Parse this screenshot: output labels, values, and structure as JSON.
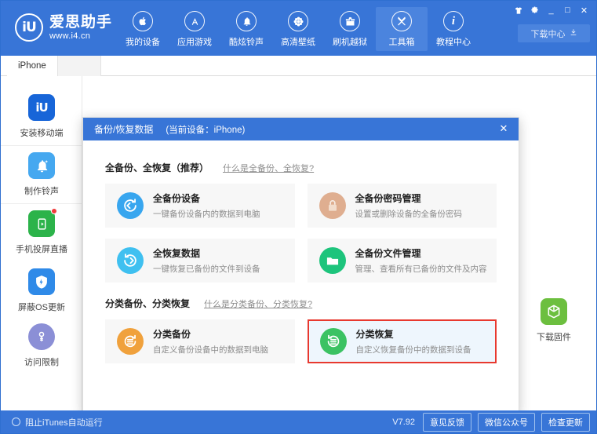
{
  "header": {
    "logo_mark": "iU",
    "brand_cn": "爱思助手",
    "brand_url": "www.i4.cn",
    "nav": [
      {
        "label": "我的设备",
        "icon": "apple-icon",
        "active": false
      },
      {
        "label": "应用游戏",
        "icon": "appstore-icon",
        "active": false
      },
      {
        "label": "酷炫铃声",
        "icon": "bell-icon",
        "active": false
      },
      {
        "label": "高清壁纸",
        "icon": "flower-icon",
        "active": false
      },
      {
        "label": "刷机越狱",
        "icon": "box-icon",
        "active": false
      },
      {
        "label": "工具箱",
        "icon": "wrench-icon",
        "active": true
      },
      {
        "label": "教程中心",
        "icon": "info-icon",
        "active": false
      }
    ],
    "window_controls": [
      "skin-icon",
      "gear-icon",
      "minimize-icon",
      "maximize-icon",
      "close-icon"
    ],
    "download_center": "下载中心"
  },
  "tabs": [
    {
      "label": "iPhone"
    }
  ],
  "sidebar": {
    "items": [
      {
        "label": "安装移动端",
        "icon": "i4-app-icon",
        "color": "#1765d8",
        "badge": false
      },
      {
        "label": "制作铃声",
        "icon": "bell-icon",
        "color": "#45a8f0",
        "badge": false
      },
      {
        "label": "手机投屏直播",
        "icon": "cast-icon",
        "color": "#2cb34a",
        "badge": true
      },
      {
        "label": "屏蔽OS更新",
        "icon": "shield-gear-icon",
        "color": "#2f8ae8",
        "badge": false
      },
      {
        "label": "访问限制",
        "icon": "key-icon",
        "color": "#8b8fd6",
        "badge": false
      }
    ]
  },
  "right_column": {
    "items": [
      {
        "label": "下载固件",
        "icon": "cube-icon",
        "color": "#6cbf3f"
      }
    ]
  },
  "dialog": {
    "title": "备份/恢复数据",
    "subtitle": "(当前设备：iPhone)",
    "close": "✕",
    "sections": [
      {
        "title": "全备份、全恢复（推荐）",
        "link": "什么是全备份、全恢复?",
        "cards": [
          {
            "title": "全备份设备",
            "desc": "一键备份设备内的数据到电脑",
            "icon": "backup-arrow-icon",
            "color": "#38a6ef",
            "highlight": false
          },
          {
            "title": "全备份密码管理",
            "desc": "设置或删除设备的全备份密码",
            "icon": "lock-icon",
            "color": "#d8a382",
            "highlight": false
          },
          {
            "title": "全恢复数据",
            "desc": "一键恢复已备份的文件到设备",
            "icon": "restore-arrow-icon",
            "color": "#3fc0f0",
            "highlight": false
          },
          {
            "title": "全备份文件管理",
            "desc": "管理、查看所有已备份的文件及内容",
            "icon": "folder-icon",
            "color": "#1dc47c",
            "highlight": false
          }
        ]
      },
      {
        "title": "分类备份、分类恢复",
        "link": "什么是分类备份、分类恢复?",
        "cards": [
          {
            "title": "分类备份",
            "desc": "自定义备份设备中的数据到电脑",
            "icon": "list-backup-icon",
            "color": "#f0a13c",
            "highlight": false
          },
          {
            "title": "分类恢复",
            "desc": "自定义恢复备份中的数据到设备",
            "icon": "list-restore-icon",
            "color": "#3bc263",
            "highlight": true
          }
        ]
      }
    ]
  },
  "footer": {
    "prevent_itunes": "阻止iTunes自动运行",
    "version": "V7.92",
    "buttons": [
      "意见反馈",
      "微信公众号",
      "检查更新"
    ]
  },
  "colors": {
    "brand_blue": "#3875d7",
    "highlight_red": "#e8392f"
  }
}
